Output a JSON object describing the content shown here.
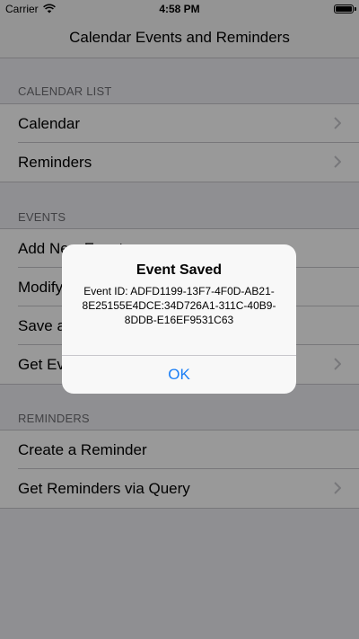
{
  "status_bar": {
    "carrier": "Carrier",
    "time": "4:58 PM",
    "wifi_icon": "wifi-icon",
    "battery_icon": "battery-icon",
    "battery_level_percent": 100
  },
  "nav": {
    "title": "Calendar Events and Reminders"
  },
  "sections": {
    "calendar_list": {
      "header": "CALENDAR LIST",
      "items": [
        {
          "label": "Calendar",
          "chevron": true
        },
        {
          "label": "Reminders",
          "chevron": true
        }
      ]
    },
    "events": {
      "header": "EVENTS",
      "items": [
        {
          "label": "Add New Event"
        },
        {
          "label": "Modify an Event"
        },
        {
          "label": "Save and Delete an Event"
        },
        {
          "label": "Get Events via Query",
          "chevron": true
        }
      ]
    },
    "reminders": {
      "header": "REMINDERS",
      "items": [
        {
          "label": "Create a Reminder"
        },
        {
          "label": "Get Reminders via Query",
          "chevron": true
        }
      ]
    }
  },
  "alert": {
    "title": "Event Saved",
    "message": "Event ID: ADFD1199-13F7-4F0D-AB21-8E25155E4DCE:34D726A1-311C-40B9-8DDB-E16EF9531C63",
    "button": "OK"
  },
  "colors": {
    "background": "#efeff4",
    "accent": "#1a7ef6",
    "separator": "#c8c7cc",
    "section_header": "#6d6d72"
  }
}
